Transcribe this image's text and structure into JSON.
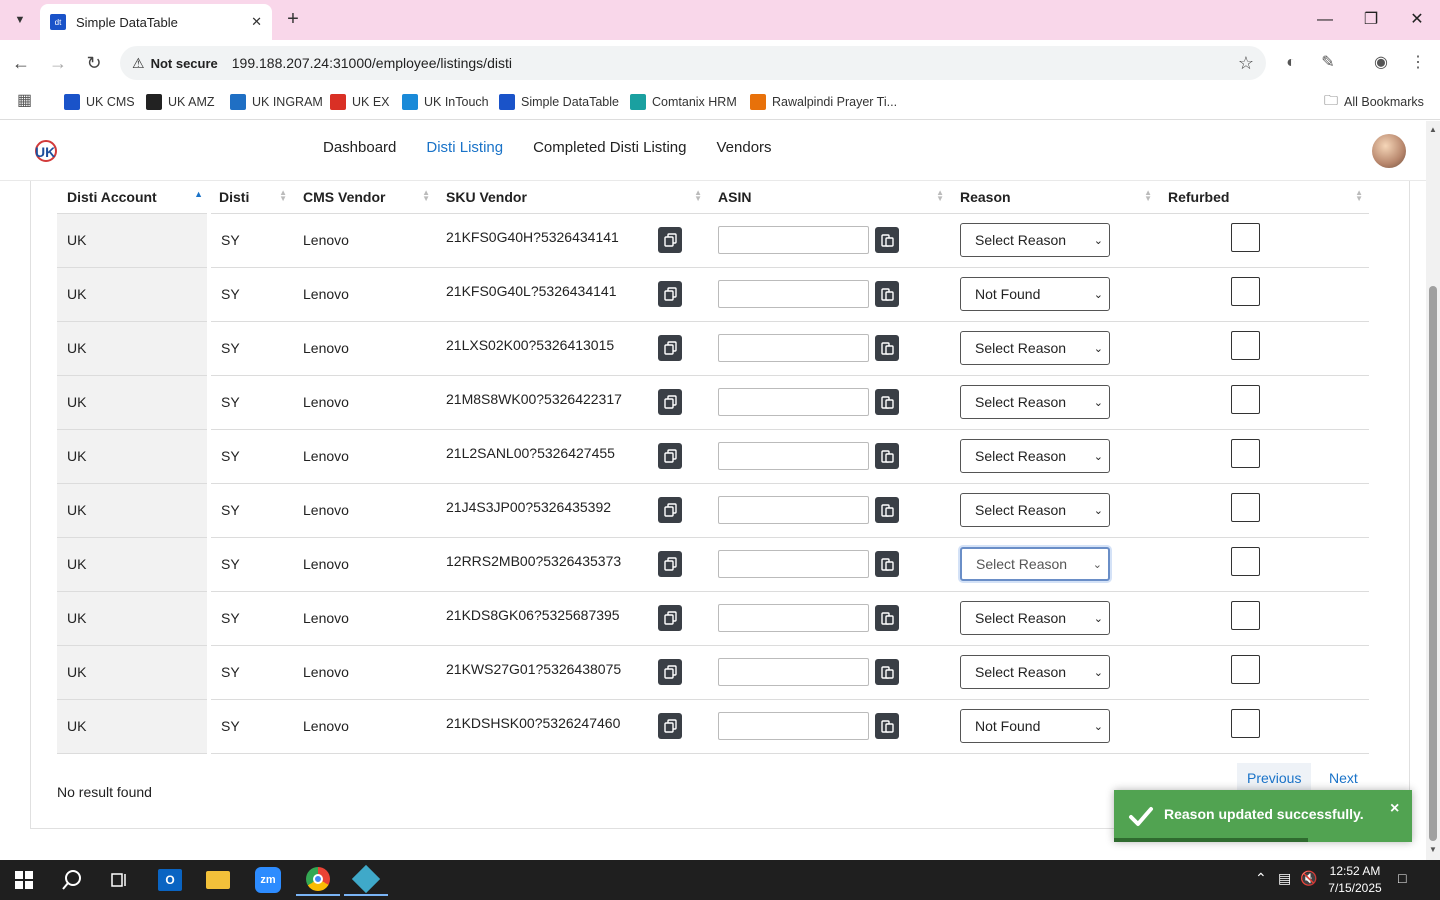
{
  "browser": {
    "tab_title": "Simple DataTable",
    "not_secure": "Not secure",
    "url": "199.188.207.24:31000/employee/listings/disti",
    "all_bookmarks": "All Bookmarks",
    "bookmarks": [
      {
        "label": "UK CMS",
        "color": "#1a53c9"
      },
      {
        "label": "UK AMZ",
        "color": "#222222"
      },
      {
        "label": "UK INGRAM",
        "color": "#1f6fc4"
      },
      {
        "label": "UK EX",
        "color": "#d93025"
      },
      {
        "label": "UK InTouch",
        "color": "#1a8ad8"
      },
      {
        "label": "Simple DataTable",
        "color": "#1a53c9"
      },
      {
        "label": "Comtanix HRM",
        "color": "#1aa0a0"
      },
      {
        "label": "Rawalpindi Prayer Ti...",
        "color": "#e8710a"
      }
    ]
  },
  "nav": {
    "items": [
      "Dashboard",
      "Disti Listing",
      "Completed Disti Listing",
      "Vendors"
    ],
    "active": "Disti Listing"
  },
  "table": {
    "columns": [
      "Disti Account",
      "Disti",
      "CMS Vendor",
      "SKU Vendor",
      "ASIN",
      "Reason",
      "Refurbed"
    ],
    "rows": [
      {
        "account": "UK",
        "disti": "SY",
        "cms_vendor": "Lenovo",
        "sku": "21KFS0G40H?5326434141",
        "asin": "",
        "reason": "Select Reason",
        "refurbed": false
      },
      {
        "account": "UK",
        "disti": "SY",
        "cms_vendor": "Lenovo",
        "sku": "21KFS0G40L?5326434141",
        "asin": "",
        "reason": "Not Found",
        "refurbed": false
      },
      {
        "account": "UK",
        "disti": "SY",
        "cms_vendor": "Lenovo",
        "sku": "21LXS02K00?5326413015",
        "asin": "",
        "reason": "Select Reason",
        "refurbed": false
      },
      {
        "account": "UK",
        "disti": "SY",
        "cms_vendor": "Lenovo",
        "sku": "21M8S8WK00?5326422317",
        "asin": "",
        "reason": "Select Reason",
        "refurbed": false
      },
      {
        "account": "UK",
        "disti": "SY",
        "cms_vendor": "Lenovo",
        "sku": "21L2SANL00?5326427455",
        "asin": "",
        "reason": "Select Reason",
        "refurbed": false
      },
      {
        "account": "UK",
        "disti": "SY",
        "cms_vendor": "Lenovo",
        "sku": "21J4S3JP00?5326435392",
        "asin": "",
        "reason": "Select Reason",
        "refurbed": false
      },
      {
        "account": "UK",
        "disti": "SY",
        "cms_vendor": "Lenovo",
        "sku": "12RRS2MB00?5326435373",
        "asin": "",
        "reason": "Select Reason",
        "refurbed": false,
        "focused": true
      },
      {
        "account": "UK",
        "disti": "SY",
        "cms_vendor": "Lenovo",
        "sku": "21KDS8GK06?5325687395",
        "asin": "",
        "reason": "Select Reason",
        "refurbed": false
      },
      {
        "account": "UK",
        "disti": "SY",
        "cms_vendor": "Lenovo",
        "sku": "21KWS27G01?5326438075",
        "asin": "",
        "reason": "Select Reason",
        "refurbed": false
      },
      {
        "account": "UK",
        "disti": "SY",
        "cms_vendor": "Lenovo",
        "sku": "21KDSHSK00?5326247460",
        "asin": "",
        "reason": "Not Found",
        "refurbed": false
      }
    ]
  },
  "footer": {
    "no_result": "No result found",
    "previous": "Previous",
    "next": "Next"
  },
  "toast": {
    "message": "Reason updated successfully.",
    "close": "×",
    "progress": 0.65
  },
  "taskbar": {
    "time": "12:52 AM",
    "date": "7/15/2025"
  },
  "colors": {
    "accent": "#1a73c8",
    "toast_bg": "#51a351",
    "tabbar": "#f9d7ea"
  }
}
